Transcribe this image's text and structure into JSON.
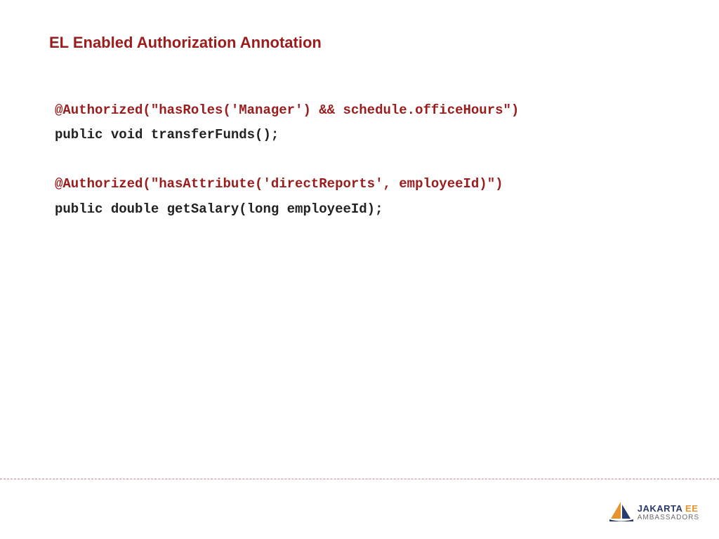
{
  "title": "EL Enabled Authorization Annotation",
  "code": {
    "block1_annotation": "@Authorized(\"hasRoles('Manager') && schedule.officeHours\")",
    "block1_signature": "public void transferFunds();",
    "block2_annotation": "@Authorized(\"hasAttribute('directReports', employeeId)\")",
    "block2_signature": "public double getSalary(long employeeId);"
  },
  "logo": {
    "brand": "JAKARTA",
    "suffix": "EE",
    "subtitle": "AMBASSADORS"
  },
  "colors": {
    "heading": "#9a1c1c",
    "annotation": "#9a1c1c",
    "signature": "#222222",
    "logo_primary": "#2a3a6a",
    "logo_accent": "#e8942e",
    "logo_subtitle": "#6b6b6b"
  }
}
